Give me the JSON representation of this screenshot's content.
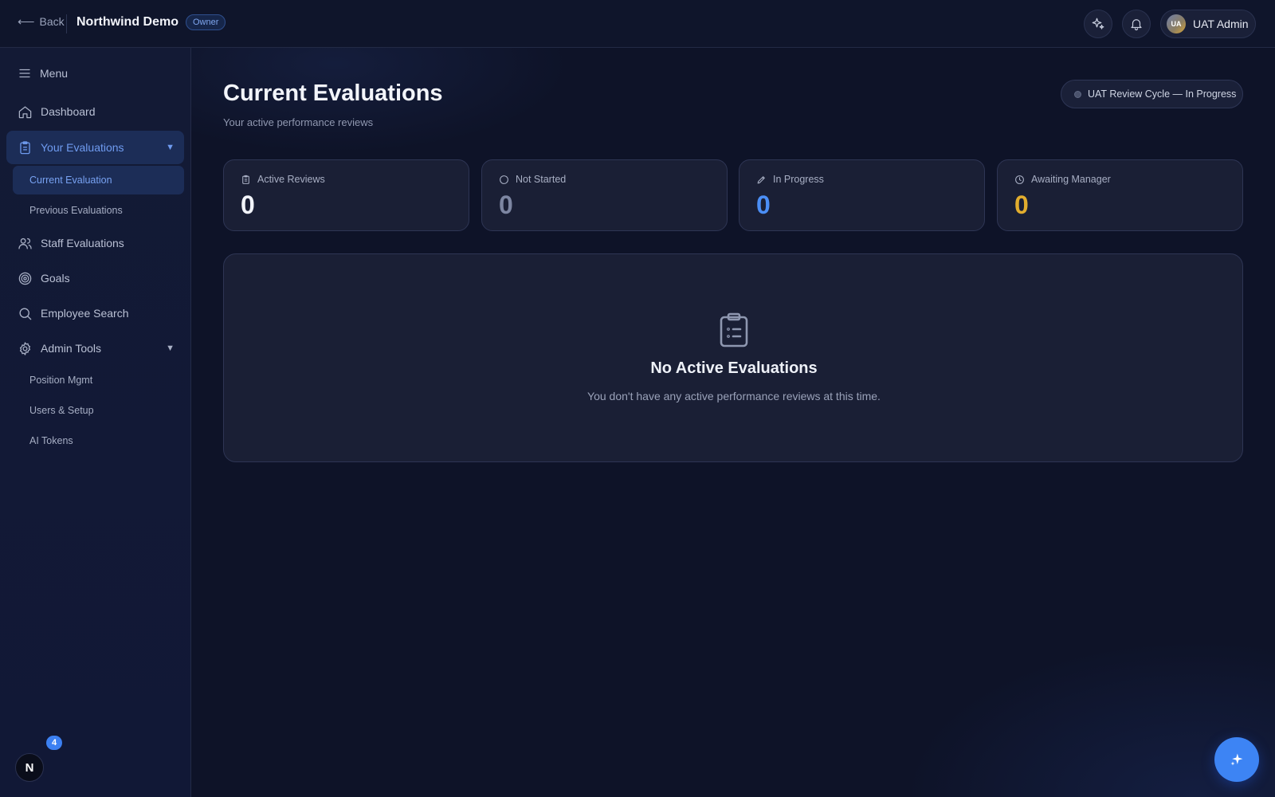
{
  "header": {
    "back_label": "Back",
    "org_name": "Northwind Demo",
    "role_badge": "Owner",
    "user_initials": "UA",
    "user_name": "UAT Admin"
  },
  "sidebar": {
    "menu_label": "Menu",
    "items": [
      {
        "label": "Dashboard",
        "icon": "home-icon"
      },
      {
        "label": "Your Evaluations",
        "icon": "clipboard-icon",
        "expanded": true,
        "active": true
      },
      {
        "label": "Staff Evaluations",
        "icon": "users-icon"
      },
      {
        "label": "Goals",
        "icon": "target-icon"
      },
      {
        "label": "Employee Search",
        "icon": "search-icon"
      },
      {
        "label": "Admin Tools",
        "icon": "gear-icon",
        "expanded": true
      }
    ],
    "evaluation_subitems": [
      "Current Evaluation",
      "Previous Evaluations"
    ],
    "admin_subitems": [
      "Position Mgmt",
      "Users & Setup",
      "AI Tokens"
    ],
    "widget_letter": "N",
    "widget_badge": "4"
  },
  "main": {
    "title": "Current Evaluations",
    "subtitle": "Your active performance reviews",
    "cycle_label": "UAT Review Cycle — In Progress",
    "stats": [
      {
        "label": "Active Reviews",
        "value": "0",
        "icon": "clipboard-icon",
        "color": "#f2f4fa"
      },
      {
        "label": "Not Started",
        "value": "0",
        "icon": "circle-icon",
        "color": "#7d86a2"
      },
      {
        "label": "In Progress",
        "value": "0",
        "icon": "pencil-icon",
        "color": "#4b8ef5"
      },
      {
        "label": "Awaiting Manager",
        "value": "0",
        "icon": "clock-icon",
        "color": "#e2ad2e"
      }
    ],
    "empty": {
      "title": "No Active Evaluations",
      "text": "You don't have any active performance reviews at this time."
    }
  },
  "colors": {
    "accent": "#3d84f4",
    "background": "#0e1328",
    "card": "#1a1f35"
  }
}
